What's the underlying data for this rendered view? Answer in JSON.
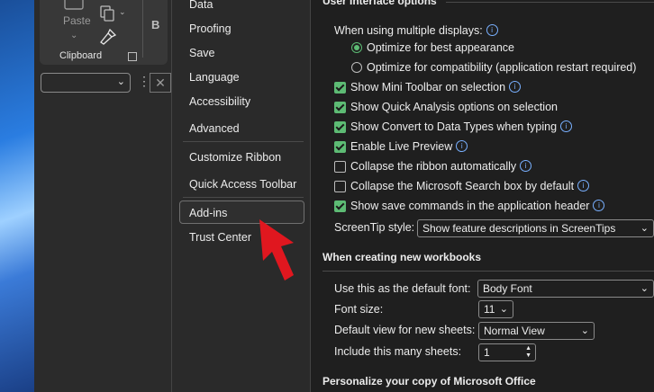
{
  "ribbon": {
    "paste_label": "Paste",
    "clipboard_label": "Clipboard",
    "bold_label": "B",
    "more_dots": "⋮",
    "cancel_glyph": "✕",
    "chevron": "⌄"
  },
  "nav": {
    "items": [
      {
        "label": "Data"
      },
      {
        "label": "Proofing"
      },
      {
        "label": "Save"
      },
      {
        "label": "Language"
      },
      {
        "label": "Accessibility"
      },
      {
        "label": "Advanced"
      },
      {
        "label": "Customize Ribbon"
      },
      {
        "label": "Quick Access Toolbar"
      },
      {
        "label": "Add-ins"
      },
      {
        "label": "Trust Center"
      }
    ],
    "selected": "Add-ins"
  },
  "main": {
    "ui_section_title": "User Interface options",
    "multi_display_label": "When using multiple displays:",
    "radio_best": "Optimize for best appearance",
    "radio_compat": "Optimize for compatibility (application restart required)",
    "checkboxes": [
      {
        "label": "Show Mini Toolbar on selection",
        "checked": true
      },
      {
        "label": "Show Quick Analysis options on selection",
        "checked": true
      },
      {
        "label": "Show Convert to Data Types when typing",
        "checked": true
      },
      {
        "label": "Enable Live Preview",
        "checked": true
      },
      {
        "label": "Collapse the ribbon automatically",
        "checked": false
      },
      {
        "label": "Collapse the Microsoft Search box by default",
        "checked": false
      },
      {
        "label": "Show save commands in the application header",
        "checked": true
      }
    ],
    "screentip_label": "ScreenTip style:",
    "screentip_value": "Show feature descriptions in ScreenTips",
    "workbook_section_title": "When creating new workbooks",
    "default_font_label": "Use this as the default font:",
    "default_font_value": "Body Font",
    "font_size_label": "Font size:",
    "font_size_value": "11",
    "default_view_label": "Default view for new sheets:",
    "default_view_value": "Normal View",
    "sheets_label": "Include this many sheets:",
    "sheets_value": "1",
    "personalize_title": "Personalize your copy of Microsoft Office"
  },
  "colors": {
    "accent_green": "#5dbb74",
    "info_blue": "#79b0ff",
    "arrow_red": "#e0171f"
  }
}
